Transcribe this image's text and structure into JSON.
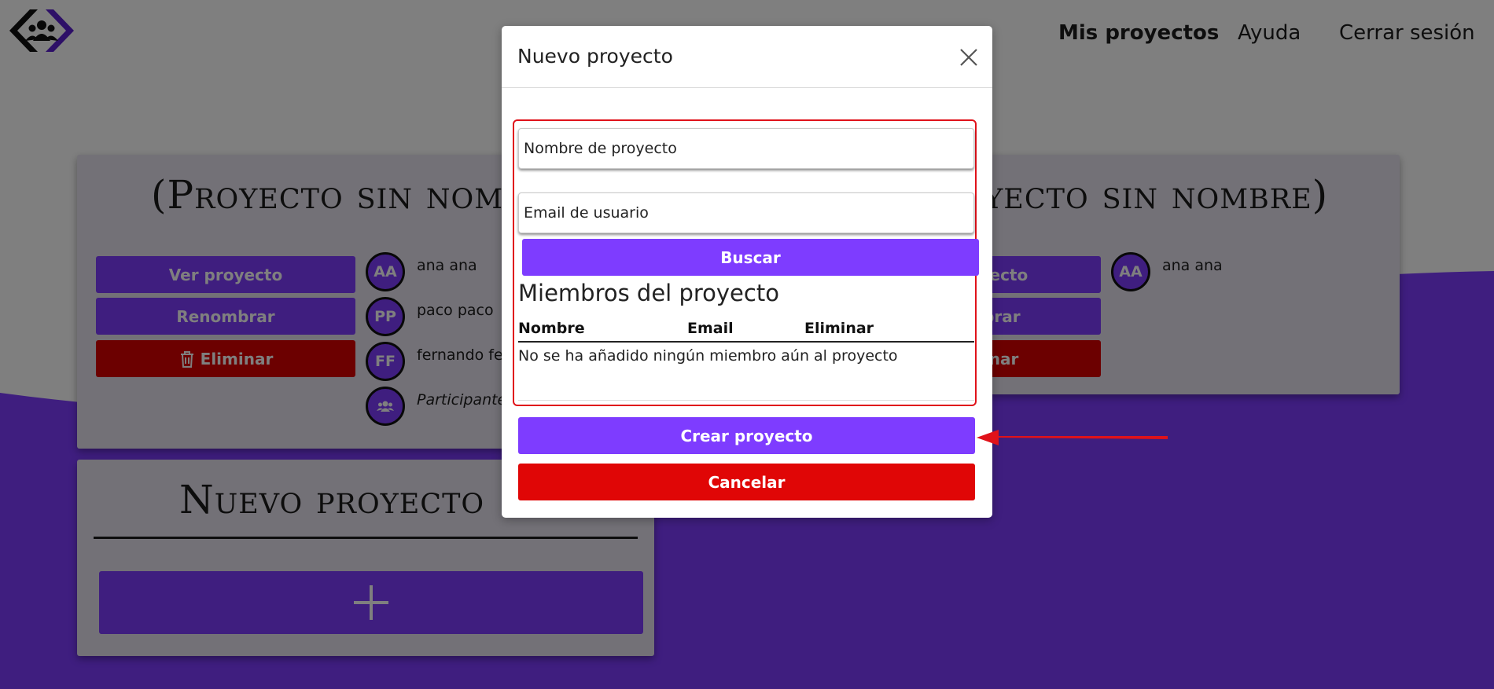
{
  "nav": {
    "items": [
      {
        "label": "Mis proyectos",
        "active": true
      },
      {
        "label": "Ayuda",
        "active": false
      },
      {
        "label": "Cerrar sesión",
        "active": false
      }
    ]
  },
  "projects": [
    {
      "title": "(Proyecto sin nombre)",
      "buttons": {
        "view": "Ver proyecto",
        "rename": "Renombrar",
        "delete": "Eliminar"
      },
      "members": [
        {
          "initials": "AA",
          "name": "ana ana"
        },
        {
          "initials": "PP",
          "name": "paco paco"
        },
        {
          "initials": "FF",
          "name": "fernando fernando"
        }
      ],
      "participants_label": "Participantes"
    },
    {
      "title": "(Proyecto sin nombre)",
      "buttons": {
        "view": "Ver proyecto",
        "rename": "Renombrar",
        "delete": "Eliminar"
      },
      "members": [
        {
          "initials": "AA",
          "name": "ana ana"
        }
      ]
    }
  ],
  "new_project_card": {
    "title": "Nuevo proyecto"
  },
  "modal": {
    "title": "Nuevo proyecto",
    "project_name_placeholder": "Nombre de proyecto",
    "user_email_placeholder": "Email de usuario",
    "search_label": "Buscar",
    "members_title": "Miembros del proyecto",
    "table_headers": [
      "Nombre",
      "Email",
      "Eliminar"
    ],
    "empty_message": "No se ha añadido ningún miembro aún al proyecto",
    "create_label": "Crear proyecto",
    "cancel_label": "Cancelar"
  },
  "colors": {
    "accent": "#7e3cff",
    "danger": "#e00606",
    "wave": "#7e3cff",
    "annotation": "#e0121a"
  }
}
